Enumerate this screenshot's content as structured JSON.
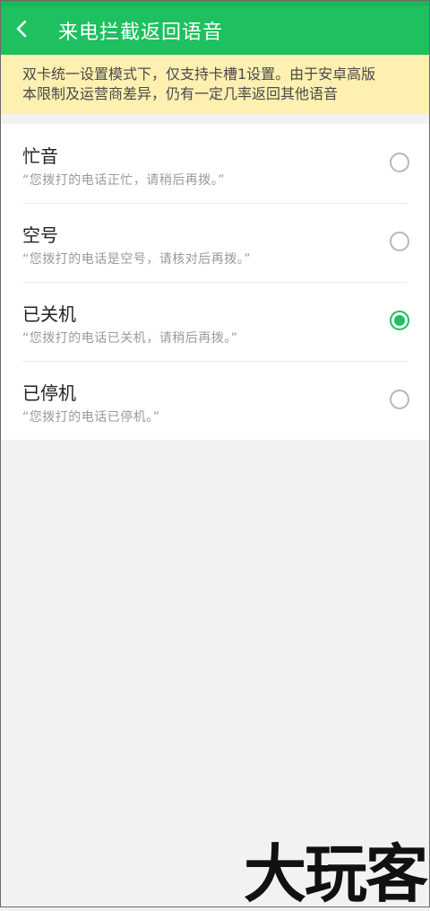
{
  "header": {
    "title": "来电拦截返回语音",
    "back_icon": "chevron-left-icon"
  },
  "colors": {
    "accent": "#1ec05f",
    "notice_bg": "#fdf0b0",
    "page_bg": "#f2f2f2"
  },
  "notice": {
    "line1": "双卡统一设置模式下，仅支持卡槽1设置。由于安卓高版",
    "line2": "本限制及运营商差异，仍有一定几率返回其他语音"
  },
  "options": [
    {
      "title": "忙音",
      "description": "“您拨打的电话正忙，请稍后再拨。”",
      "selected": false
    },
    {
      "title": "空号",
      "description": "“您拨打的电话是空号，请核对后再拨。”",
      "selected": false
    },
    {
      "title": "已关机",
      "description": "“您拨打的电话已关机，请稍后再拨。”",
      "selected": true
    },
    {
      "title": "已停机",
      "description": "“您拨打的电话已停机。”",
      "selected": false
    }
  ],
  "watermark": "大玩客"
}
